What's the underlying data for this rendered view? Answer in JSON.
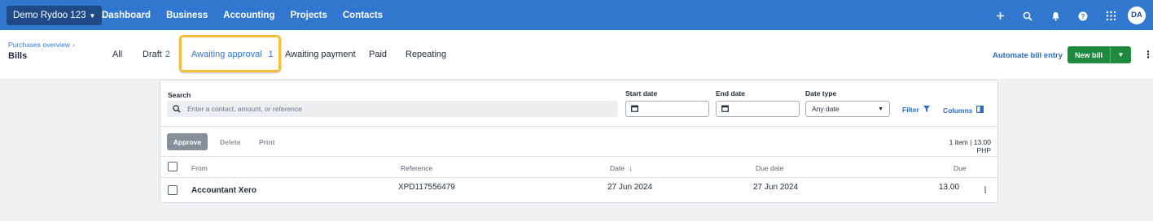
{
  "topnav": {
    "org_label": "Demo Rydoo 123",
    "links": [
      "Dashboard",
      "Business",
      "Accounting",
      "Projects",
      "Contacts"
    ],
    "icons": [
      "plus-icon",
      "search-icon",
      "bell-icon",
      "help-icon",
      "apps-grid-icon"
    ],
    "avatar_initials": "DA",
    "colors": {
      "bar": "#3277cf",
      "org_button": "#1f4a86"
    }
  },
  "header": {
    "breadcrumb": "Purchases overview",
    "title": "Bills",
    "tabs": [
      {
        "label": "All",
        "count": ""
      },
      {
        "label": "Draft",
        "count": "2"
      },
      {
        "label": "Awaiting approval",
        "count": "1",
        "active": true
      },
      {
        "label": "Awaiting payment",
        "count": ""
      },
      {
        "label": "Paid",
        "count": ""
      },
      {
        "label": "Repeating",
        "count": ""
      }
    ],
    "automate_label": "Automate bill entry",
    "new_bill_label": "New bill",
    "colors": {
      "highlight": "#f2be3b",
      "new_bill": "#1e8a3e"
    }
  },
  "filters": {
    "search_label": "Search",
    "search_placeholder": "Enter a contact, amount, or reference",
    "start_date_label": "Start date",
    "end_date_label": "End date",
    "date_type_label": "Date type",
    "date_type_value": "Any date",
    "filter_label": "Filter",
    "columns_label": "Columns"
  },
  "actions": {
    "approve": "Approve",
    "delete": "Delete",
    "print": "Print",
    "summary": "1 item | 13.00 PHP"
  },
  "table": {
    "columns": [
      "From",
      "Reference",
      "Date",
      "Due date",
      "Due"
    ],
    "sort_indicator": "↓",
    "rows": [
      {
        "from": "Accountant Xero",
        "reference": "XPD117556479",
        "date": "27 Jun 2024",
        "due_date": "27 Jun 2024",
        "due": "13.00"
      }
    ]
  }
}
